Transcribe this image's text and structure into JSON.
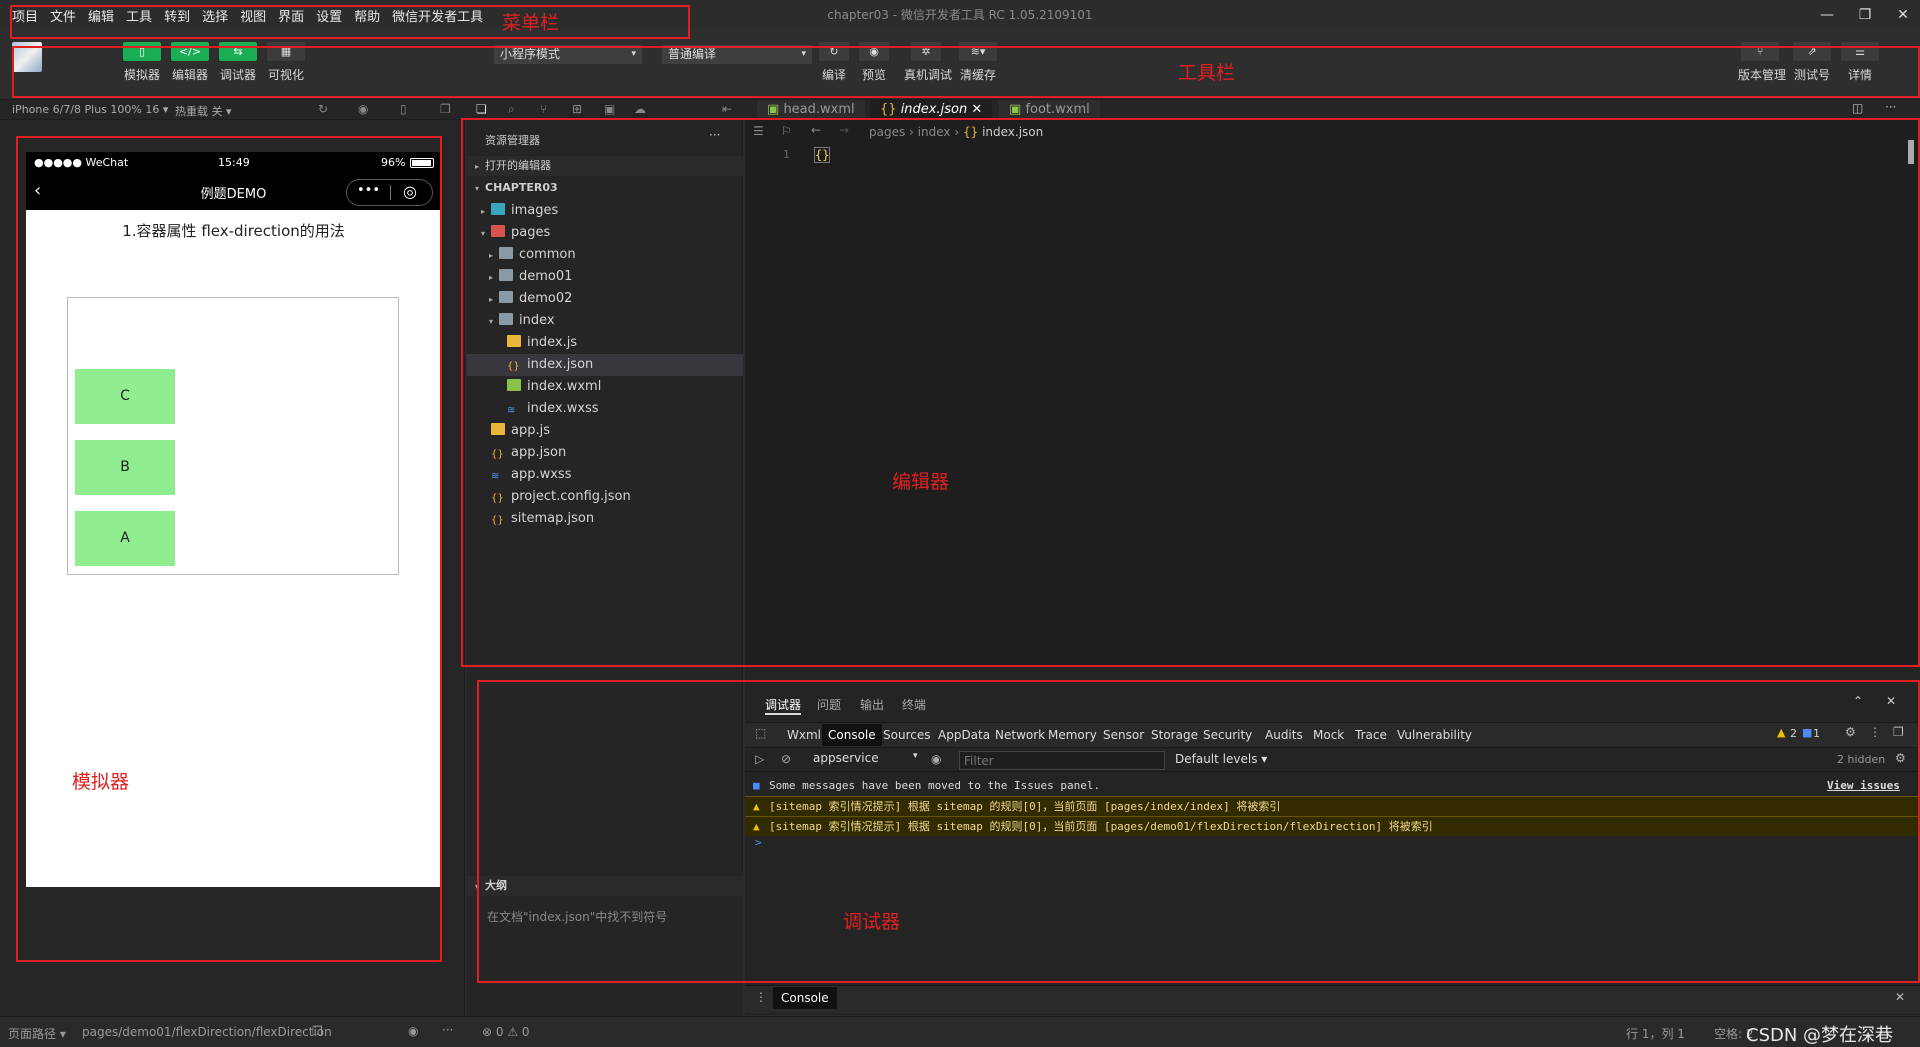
{
  "menubar": {
    "items": [
      "项目",
      "文件",
      "编辑",
      "工具",
      "转到",
      "选择",
      "视图",
      "界面",
      "设置",
      "帮助",
      "微信开发者工具"
    ],
    "window_title": "chapter03 - 微信开发者工具 RC 1.05.2109101"
  },
  "toolbar": {
    "left_buttons": [
      "模拟器",
      "编辑器",
      "调试器",
      "可视化"
    ],
    "mode_select": "小程序模式",
    "compile_select": "普通编译",
    "mid_buttons": [
      "编译",
      "预览",
      "真机调试",
      "清缓存"
    ],
    "right_buttons": [
      "版本管理",
      "测试号",
      "详情"
    ]
  },
  "subbar": {
    "device": "iPhone 6/7/8 Plus 100% 16",
    "hot_reload": "热重载 关"
  },
  "simulator": {
    "status_signal": "●●●●● WeChat",
    "status_time": "15:49",
    "status_battery": "96%",
    "nav_title": "例题DEMO",
    "page_heading": "1.容器属性 flex-direction的用法",
    "boxes": [
      "C",
      "B",
      "A"
    ]
  },
  "explorer": {
    "title": "资源管理器",
    "open_editors": "打开的编辑器",
    "project": "CHAPTER03",
    "tree": [
      {
        "name": "images",
        "depth": 1,
        "type": "folder-img",
        "arrow": "▸"
      },
      {
        "name": "pages",
        "depth": 1,
        "type": "folder-red",
        "arrow": "▾"
      },
      {
        "name": "common",
        "depth": 2,
        "type": "folder",
        "arrow": "▸"
      },
      {
        "name": "demo01",
        "depth": 2,
        "type": "folder",
        "arrow": "▸"
      },
      {
        "name": "demo02",
        "depth": 2,
        "type": "folder",
        "arrow": "▸"
      },
      {
        "name": "index",
        "depth": 2,
        "type": "folder",
        "arrow": "▾"
      },
      {
        "name": "index.js",
        "depth": 3,
        "type": "js"
      },
      {
        "name": "index.json",
        "depth": 3,
        "type": "json",
        "selected": true
      },
      {
        "name": "index.wxml",
        "depth": 3,
        "type": "wxml"
      },
      {
        "name": "index.wxss",
        "depth": 3,
        "type": "wxss"
      },
      {
        "name": "app.js",
        "depth": 1,
        "type": "js"
      },
      {
        "name": "app.json",
        "depth": 1,
        "type": "json"
      },
      {
        "name": "app.wxss",
        "depth": 1,
        "type": "wxss"
      },
      {
        "name": "project.config.json",
        "depth": 1,
        "type": "json"
      },
      {
        "name": "sitemap.json",
        "depth": 1,
        "type": "json"
      }
    ]
  },
  "outline": {
    "title": "大纲",
    "message": "在文档\"index.json\"中找不到符号"
  },
  "editor": {
    "tabs": [
      "head.wxml",
      "index.json",
      "foot.wxml"
    ],
    "breadcrumb": [
      "pages",
      "index",
      "index.json"
    ],
    "line_number": "1",
    "line_content": "{}"
  },
  "debugger": {
    "top_tabs": [
      "调试器",
      "问题",
      "输出",
      "终端"
    ],
    "console_tabs": [
      "Wxml",
      "Console",
      "Sources",
      "AppData",
      "Network",
      "Memory",
      "Sensor",
      "Storage",
      "Security",
      "Audits",
      "Mock",
      "Trace",
      "Vulnerability"
    ],
    "warn_count": "2",
    "info_count": "1",
    "context": "appservice",
    "filter_placeholder": "Filter",
    "levels": "Default levels",
    "hidden": "2 hidden",
    "messages": [
      {
        "type": "info",
        "text": "Some messages have been moved to the Issues panel.",
        "link": "View issues"
      },
      {
        "type": "warn",
        "text": "[sitemap 索引情况提示] 根据 sitemap 的规则[0]，当前页面 [pages/index/index] 将被索引"
      },
      {
        "type": "warn",
        "text": "[sitemap 索引情况提示] 根据 sitemap 的规则[0]，当前页面 [pages/demo01/flexDirection/flexDirection] 将被索引"
      }
    ],
    "prompt": ">",
    "drawer_tab": "Console"
  },
  "statusbar": {
    "page_path_label": "页面路径",
    "page_path": "pages/demo01/flexDirection/flexDirection",
    "errors": "⊗ 0 ⚠ 0",
    "cursor": "行 1，列 1",
    "spaces": "空格: 2",
    "watermark": "CSDN @梦在深巷"
  },
  "annotations": {
    "menubar": "菜单栏",
    "toolbar": "工具栏",
    "editor": "编辑器",
    "simulator": "模拟器",
    "debugger": "调试器"
  },
  "colors": {
    "annotation": "#e02020",
    "green_button": "#1aad53",
    "box": "#90ee90"
  }
}
